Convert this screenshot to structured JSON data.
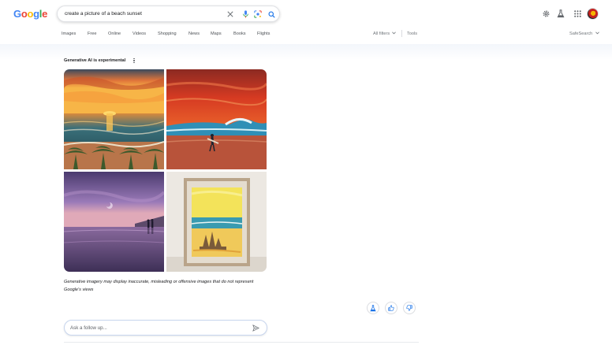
{
  "logo": {
    "text": "Google",
    "letters": [
      {
        "ch": "G",
        "color": "#4285F4"
      },
      {
        "ch": "o",
        "color": "#EA4335"
      },
      {
        "ch": "o",
        "color": "#FBBC05"
      },
      {
        "ch": "g",
        "color": "#4285F4"
      },
      {
        "ch": "l",
        "color": "#34A853"
      },
      {
        "ch": "e",
        "color": "#EA4335"
      }
    ]
  },
  "search": {
    "query": "create a picture of a beach sunset",
    "icons": [
      "close-icon",
      "mic-icon",
      "lens-icon",
      "search-icon"
    ]
  },
  "header_right": {
    "icons": [
      "gear-icon",
      "labs-flask-icon",
      "apps-grid-icon",
      "avatar"
    ]
  },
  "tabs": [
    "Images",
    "Free",
    "Online",
    "Videos",
    "Shopping",
    "News",
    "Maps",
    "Books",
    "Flights"
  ],
  "tools": {
    "all_filters": "All filters",
    "tools": "Tools",
    "safesearch": "SafeSearch"
  },
  "ai": {
    "label": "Generative AI is experimental",
    "images": [
      {
        "name": "sunset-ocean-palms"
      },
      {
        "name": "red-sky-surfer"
      },
      {
        "name": "purple-dusk-couple"
      },
      {
        "name": "framed-sandcastle-painting"
      }
    ],
    "disclaimer_line1": "Generative imagery may display inaccurate, misleading or offensive images that do not represent",
    "disclaimer_line2": "Google's views"
  },
  "feedback": {
    "icons": [
      "labs-flask-icon",
      "thumbs-up-icon",
      "thumbs-down-icon"
    ]
  },
  "followup": {
    "placeholder": "Ask a follow up..."
  },
  "colors": {
    "accent": "#1a73e8",
    "border": "#dfe1e5"
  }
}
